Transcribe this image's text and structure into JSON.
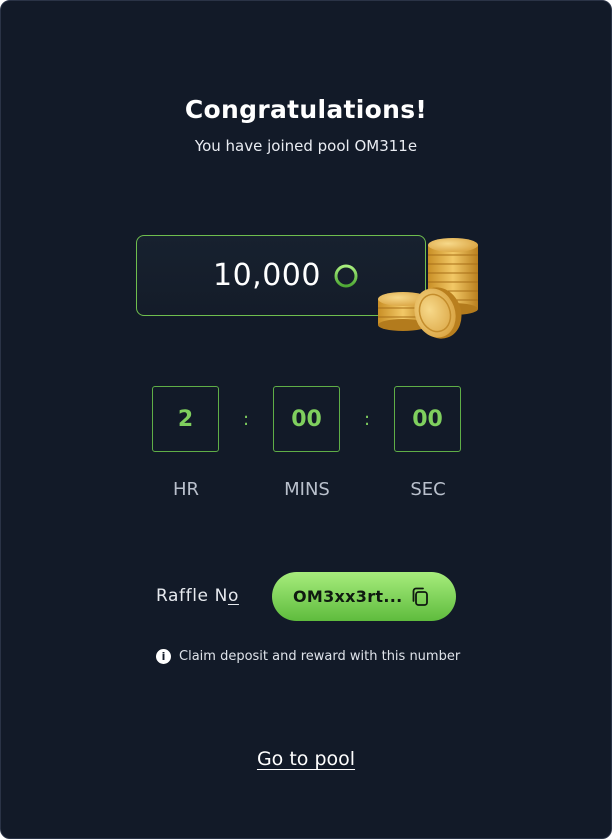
{
  "header": {
    "title": "Congratulations!",
    "subtitle": "You have joined pool OM311e"
  },
  "deposit": {
    "amount": "10,000",
    "token_icon": "token-ring-icon",
    "illustration": "coin-stack-icon"
  },
  "countdown": {
    "hours": "2",
    "minutes": "00",
    "seconds": "00",
    "separator": ":",
    "hours_label": "HR",
    "minutes_label": "MINS",
    "seconds_label": "SEC"
  },
  "raffle": {
    "label_prefix": "Raffle N",
    "label_suffix": "o",
    "code": "OM3xx3rt...",
    "copy_icon": "copy-icon",
    "info_icon": "info-icon",
    "info_glyph": "i",
    "info_text": "Claim deposit and reward with this number"
  },
  "footer": {
    "link_label": "Go to pool"
  },
  "colors": {
    "background": "#121a28",
    "accent": "#7fcf5e",
    "pill_gradient_top": "#a7ec7c",
    "pill_gradient_bottom": "#5fbc3d"
  }
}
